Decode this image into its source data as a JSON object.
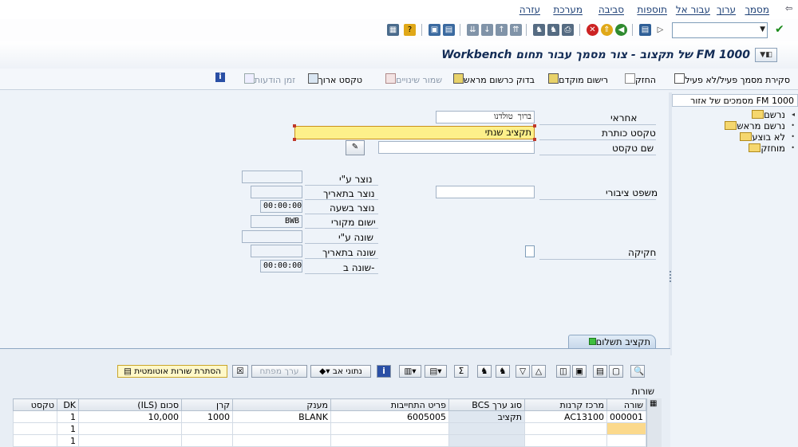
{
  "menu": {
    "items": [
      "מסמך",
      "ערוך",
      "עבור אל",
      "תוספות",
      "סביבה",
      "מערכת",
      "עזרה"
    ]
  },
  "toolbar": {
    "command_field_value": ""
  },
  "title": {
    "text": "Workbench של תקצוב - צור מסמך עבור תחום FM 1000"
  },
  "app_toolbar": {
    "toggle_label": "סקירת מסמך פעיל/לא פעיל",
    "hold_label": "החזק",
    "park_label": "רישום מוקדם",
    "check_label": "בדוק כרשום מראש",
    "save_changes_label": "שמור שינויים",
    "long_text_label": "טקסט ארוך",
    "message_time_label": "זמן הודעות"
  },
  "tree": {
    "header": "מסמכים של אזור FM 1000",
    "nodes": [
      "נרשם",
      "נרשם מראש",
      "לא בוצע",
      "מוחזק"
    ]
  },
  "form": {
    "responsible_label": "אחראי",
    "responsible_value": "ברוך טולדנו",
    "header_text_label": "טקסט כותרת",
    "header_text_value": "תקציב שנתי",
    "text_name_label": "שם טקסט",
    "text_name_value": "",
    "public_law_label": "משפט ציבורי",
    "public_law_value": "",
    "legislation_label": "חקיקה",
    "created_by_label": "נוצר ע\"י",
    "created_by_value": "",
    "created_on_label": "נוצר בתאריך",
    "created_on_value": "",
    "created_at_label": "נוצר בשעה",
    "created_at_value": "00:00:00",
    "orig_app_label": "ישום מקורי",
    "orig_app_value": "BWB",
    "changed_by_label": "שונה ע\"י",
    "changed_by_value": "",
    "changed_on_label": "שונה בתאריך",
    "changed_on_value": "",
    "changed_at_label": "שונה ב-",
    "changed_at_value": "00:00:00"
  },
  "tab": {
    "label": "תקציב תשלום"
  },
  "grid_toolbar": {
    "data_label": "נתוני אב",
    "key_value_label": "ערך מפתח",
    "auto_rows_label": "הסתרת שורות אוטומטית"
  },
  "grid": {
    "caption": "שורות",
    "columns": [
      "שורה",
      "מרכז קרנות",
      "סוג ערך BCS",
      "פריט התחייבות",
      "מענק",
      "קרן",
      "סכום (ILS)",
      "DK",
      "טקסט"
    ],
    "rows": [
      [
        "000001",
        "AC13100",
        "תקציב",
        "6005005",
        "BLANK",
        "1000",
        "10,000",
        "1",
        ""
      ],
      [
        "",
        "",
        "",
        "",
        "",
        "",
        "",
        "1",
        ""
      ],
      [
        "",
        "",
        "",
        "",
        "",
        "",
        "",
        "1",
        ""
      ]
    ]
  }
}
